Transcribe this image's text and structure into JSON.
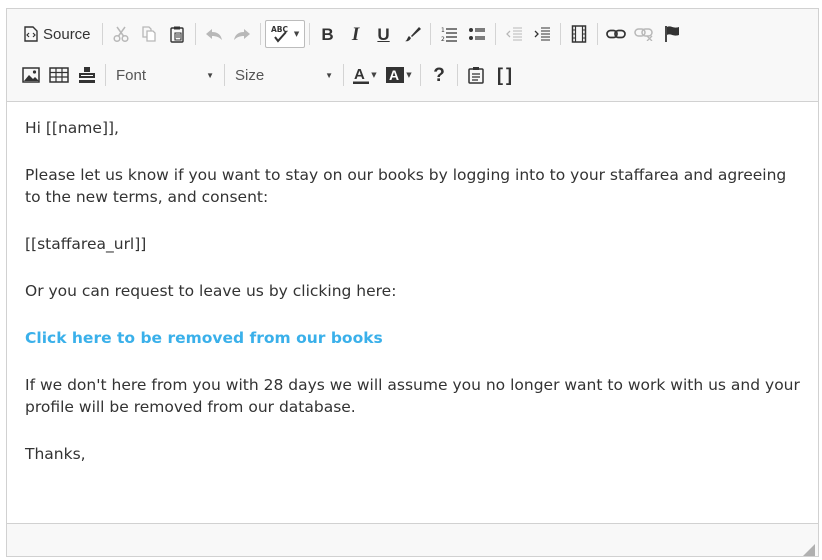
{
  "toolbar": {
    "source_label": "Source",
    "font_combo": "Font",
    "size_combo": "Size",
    "help_glyph": "?",
    "showblocks_glyph": "[ ]"
  },
  "content": {
    "greeting": "Hi [[name]],",
    "paragraph1": "Please let us know if you want to stay on our books by logging into to your staffarea and agreeing to the new terms, and consent:",
    "placeholder_url": "[[staffarea_url]]",
    "paragraph2": "Or you can request to leave us by clicking here:",
    "remove_link": "Click here to be removed from our books",
    "paragraph3": "If we don't here from you with 28 days we will assume you no longer want to work with us and your profile will be removed from our database.",
    "signoff": "Thanks,"
  },
  "colors": {
    "link": "#3ab0ea",
    "text": "#333333",
    "toolbar_bg": "#f8f8f8",
    "border": "#d1d1d1"
  }
}
